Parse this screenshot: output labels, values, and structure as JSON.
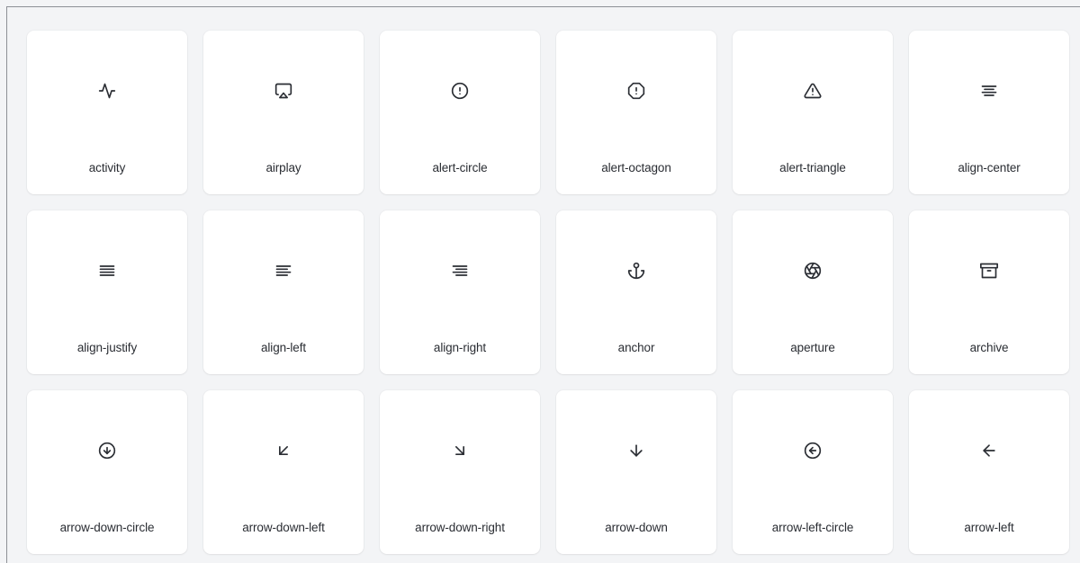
{
  "icons": [
    {
      "name": "activity",
      "icon": "activity-icon"
    },
    {
      "name": "airplay",
      "icon": "airplay-icon"
    },
    {
      "name": "alert-circle",
      "icon": "alert-circle-icon"
    },
    {
      "name": "alert-octagon",
      "icon": "alert-octagon-icon"
    },
    {
      "name": "alert-triangle",
      "icon": "alert-triangle-icon"
    },
    {
      "name": "align-center",
      "icon": "align-center-icon"
    },
    {
      "name": "align-justify",
      "icon": "align-justify-icon"
    },
    {
      "name": "align-left",
      "icon": "align-left-icon"
    },
    {
      "name": "align-right",
      "icon": "align-right-icon"
    },
    {
      "name": "anchor",
      "icon": "anchor-icon"
    },
    {
      "name": "aperture",
      "icon": "aperture-icon"
    },
    {
      "name": "archive",
      "icon": "archive-icon"
    },
    {
      "name": "arrow-down-circle",
      "icon": "arrow-down-circle-icon"
    },
    {
      "name": "arrow-down-left",
      "icon": "arrow-down-left-icon"
    },
    {
      "name": "arrow-down-right",
      "icon": "arrow-down-right-icon"
    },
    {
      "name": "arrow-down",
      "icon": "arrow-down-icon"
    },
    {
      "name": "arrow-left-circle",
      "icon": "arrow-left-circle-icon"
    },
    {
      "name": "arrow-left",
      "icon": "arrow-left-icon"
    }
  ],
  "colors": {
    "background": "#f3f4f6",
    "card": "#ffffff",
    "icon_stroke": "#2b2e34",
    "label_text": "#2a2d33"
  }
}
